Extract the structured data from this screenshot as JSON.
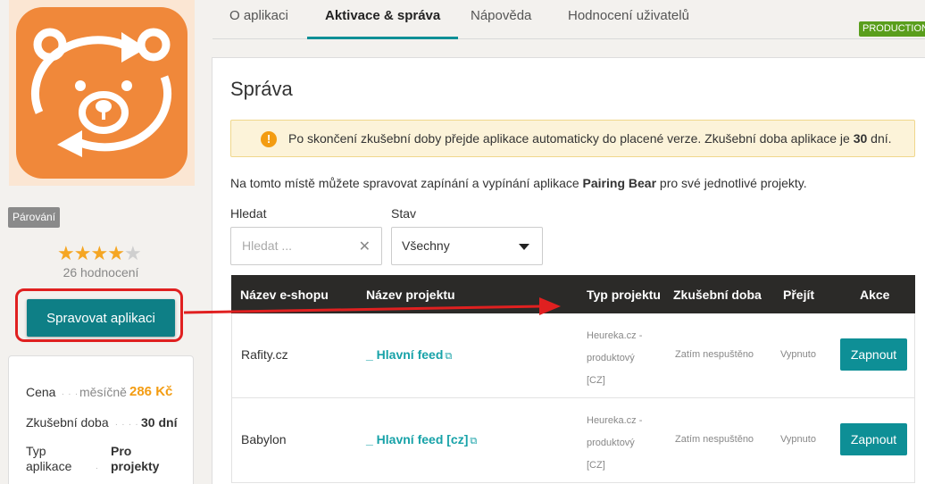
{
  "sidebar": {
    "category": "Párování",
    "rating": {
      "value": 4,
      "max": 5,
      "count_label": "26 hodnocení"
    },
    "manage_button": "Spravovat aplikaci",
    "info": {
      "price_label": "Cena",
      "price_unit": "měsíčně",
      "price_value": "286 Kč",
      "trial_label": "Zkušební doba",
      "trial_value": "30 dní",
      "type_label_1": "Typ",
      "type_label_2": "aplikace",
      "type_value_1": "Pro",
      "type_value_2": "projekty"
    }
  },
  "tabs": [
    {
      "label": "O aplikaci"
    },
    {
      "label": "Aktivace & správa"
    },
    {
      "label": "Nápověda"
    },
    {
      "label": "Hodnocení uživatelů"
    }
  ],
  "env_badge": "PRODUCTION",
  "panel": {
    "title": "Správa",
    "alert": {
      "before": "Po skončení zkušební doby přejde aplikace automaticky do placené verze. Zkušební doba aplikace je ",
      "days": "30",
      "after": " dní."
    },
    "desc": {
      "before": "Na tomto místě můžete spravovat zapínání a vypínání aplikace ",
      "app_name": "Pairing Bear",
      "after": " pro své jednotlivé projekty."
    },
    "search": {
      "label": "Hledat",
      "placeholder": "Hledat ..."
    },
    "status": {
      "label": "Stav",
      "value": "Všechny"
    }
  },
  "table": {
    "headers": {
      "shop": "Název e-shopu",
      "project": "Název projektu",
      "type": "Typ projektu",
      "trial": "Zkušební doba",
      "goto": "Přejít",
      "actions": "Akce"
    },
    "rows": [
      {
        "shop": "Rafity.cz",
        "project": "_ Hlavní feed",
        "type_lines": [
          "Heureka.cz -",
          "produktový",
          "[CZ]"
        ],
        "trial": "Zatím nespuštěno",
        "goto": "Vypnuto",
        "action": "Zapnout"
      },
      {
        "shop": "Babylon",
        "project": "_ Hlavní feed [cz]",
        "type_lines": [
          "Heureka.cz -",
          "produktový",
          "[CZ]"
        ],
        "trial": "Zatím nespuštěno",
        "goto": "Vypnuto",
        "action": "Zapnout"
      }
    ]
  },
  "colors": {
    "accent": "#0e8f96",
    "logo_orange": "#f0883a",
    "highlight_red": "#e02020",
    "price_orange": "#f39c12"
  }
}
